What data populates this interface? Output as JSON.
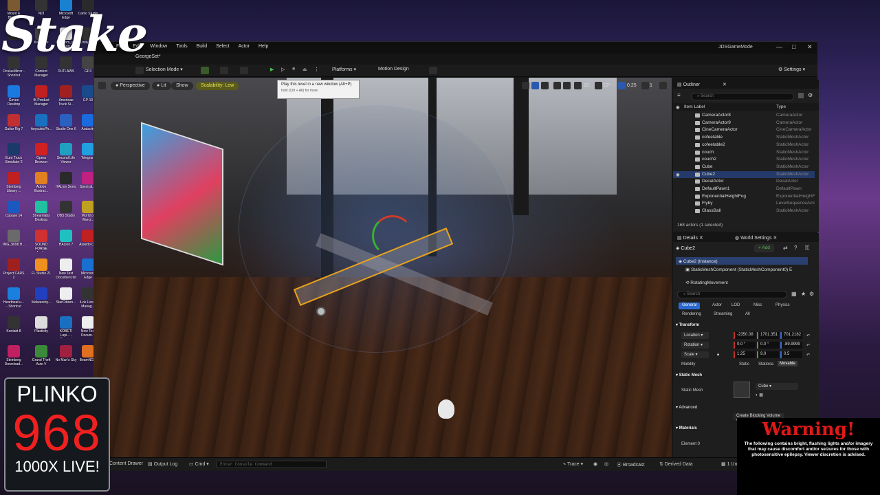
{
  "desktop": {
    "icons_col1": [
      {
        "label": "Mount & Blade II",
        "color": "#7a5a30"
      },
      {
        "label": "",
        "color": "#2a2a2a"
      },
      {
        "label": "OculusMirror - Shortcut",
        "color": "#333"
      },
      {
        "label": "Govee Desktop",
        "color": "#1a7ae0"
      },
      {
        "label": "Guitar Rig 7",
        "color": "#c03030"
      },
      {
        "label": "Euro Truck Simulator 2",
        "color": "#1a3a6a"
      },
      {
        "label": "Steinberg Library ...",
        "color": "#c02020"
      },
      {
        "label": "Cubase 14",
        "color": "#1a5ac0"
      },
      {
        "label": "IMG_9098.H...",
        "color": "#6a6a6a"
      },
      {
        "label": "Project CARS 2",
        "color": "#a02020"
      },
      {
        "label": "Heartbeat.u... - Shortcut",
        "color": "#1a80e0"
      },
      {
        "label": "Kontakt 8",
        "color": "#333"
      },
      {
        "label": "Steinberg Download...",
        "color": "#c02060"
      }
    ],
    "icons_col2": [
      {
        "label": "NDI",
        "color": "#333"
      },
      {
        "label": "Komplete",
        "color": "#444"
      },
      {
        "label": "Content Manager",
        "color": "#333"
      },
      {
        "label": "IK Product Manager",
        "color": "#c02020"
      },
      {
        "label": "AnycubicPh...",
        "color": "#1a70c0"
      },
      {
        "label": "Opera Browser",
        "color": "#d02020"
      },
      {
        "label": "Adobe Illustrat...",
        "color": "#e08020"
      },
      {
        "label": "Streamlabs Desktop",
        "color": "#20c0a0"
      },
      {
        "label": "SOUND FORGE Audi...",
        "color": "#d03030"
      },
      {
        "label": "FL Studio 21",
        "color": "#f09020"
      },
      {
        "label": "Malwareby...",
        "color": "#2040c0"
      },
      {
        "label": "Plasticity",
        "color": "#ddd"
      },
      {
        "label": "Grand Theft Auto V",
        "color": "#3a8a3a"
      }
    ],
    "icons_col3": [
      {
        "label": "Microsoft Edge",
        "color": "#1a80d0"
      },
      {
        "label": "Freedom_s... Shortcut",
        "color": "#ddd"
      },
      {
        "label": "OUTLAWS",
        "color": "#333"
      },
      {
        "label": "American Truck Si...",
        "color": "#a02020"
      },
      {
        "label": "Studio One 6",
        "color": "#2a60c0"
      },
      {
        "label": "Second Life Viewer",
        "color": "#20a0c0"
      },
      {
        "label": "HALion Sonic",
        "color": "#2a2a2a"
      },
      {
        "label": "OBS Studio",
        "color": "#333"
      },
      {
        "label": "HALion 7",
        "color": "#20c0c0"
      },
      {
        "label": "New Text Document.txt",
        "color": "#eee"
      },
      {
        "label": "StarCitizen...",
        "color": "#eee"
      },
      {
        "label": "KOBETI Lupi... - Shortcut",
        "color": "#1a70c0"
      },
      {
        "label": "No Man's Sky",
        "color": "#a02040"
      }
    ],
    "icons_col4": [
      {
        "label": "Camo Studio",
        "color": "#2a2a2a"
      },
      {
        "label": "Unity Hub",
        "color": "#333"
      },
      {
        "label": "GP4",
        "color": "#444"
      },
      {
        "label": "GP-10",
        "color": "#1a4a8a"
      },
      {
        "label": "Audacity",
        "color": "#1a6ae0"
      },
      {
        "label": "Telegram",
        "color": "#20a0e0"
      },
      {
        "label": "SpectraL...",
        "color": "#c02080"
      },
      {
        "label": "World of Warcr...",
        "color": "#c0a020"
      },
      {
        "label": "Assetto C...",
        "color": "#c02020"
      },
      {
        "label": "Microsoft Edge",
        "color": "#1a70d0"
      },
      {
        "label": "iLok Lice... Manag...",
        "color": "#333"
      },
      {
        "label": "New Text Docum...",
        "color": "#eee"
      },
      {
        "label": "BeamNG...",
        "color": "#e07020"
      }
    ]
  },
  "overlay": {
    "stake_logo": "Stake",
    "plinko_title": "PLINKO",
    "plinko_number": "968",
    "plinko_sub": "1000X LIVE!",
    "warning_title": "Warning!",
    "warning_text": "The following contains bright, flashing lights and/or imagery that may cause discomfort and/or seizures for those with photosensitive epilepsy. Viewer discretion is advised."
  },
  "editor": {
    "window_title": "JDSGameMode",
    "menu": [
      "File",
      "Edit",
      "Window",
      "Tools",
      "Build",
      "Select",
      "Actor",
      "Help"
    ],
    "level_tab": "GeorgeSet*",
    "toolbar": {
      "selection_mode": "Selection Mode",
      "platforms": "Platforms",
      "motion_design": "Motion Design",
      "settings": "Settings"
    },
    "viewport": {
      "perspective": "Perspective",
      "lit": "Lit",
      "show": "Show",
      "scalability": "Scalability: Low",
      "grid_snap": "10",
      "rot_snap": "10°",
      "scale_snap": "0.25",
      "camera_speed": "1",
      "tooltip_title": "Play this level in a new window (Alt+P)",
      "tooltip_hint": "hold (Ctrl + Alt) for more"
    },
    "bottom": {
      "content_drawer": "Content Drawer",
      "output_log": "Output Log",
      "cmd": "Cmd",
      "console_placeholder": "Enter Console Command",
      "trace": "Trace",
      "broadcast": "Broadcast",
      "derived_data": "Derived Data",
      "unsaved": "1 Un"
    },
    "outliner": {
      "title": "Outliner",
      "search_placeholder": "Search",
      "col_label": "Item Label",
      "col_type": "Type",
      "rows": [
        {
          "name": "CameraActor8",
          "type": "CameraActor",
          "selected": false
        },
        {
          "name": "CameraActor9",
          "type": "CameraActor",
          "selected": false
        },
        {
          "name": "CineCameraActor",
          "type": "CineCameraActor",
          "selected": false
        },
        {
          "name": "cofeetable",
          "type": "StaticMeshActor",
          "selected": false
        },
        {
          "name": "cofeetable2",
          "type": "StaticMeshActor",
          "selected": false
        },
        {
          "name": "couch",
          "type": "StaticMeshActor",
          "selected": false
        },
        {
          "name": "couch2",
          "type": "StaticMeshActor",
          "selected": false
        },
        {
          "name": "Cube",
          "type": "StaticMeshActor",
          "selected": false
        },
        {
          "name": "Cube2",
          "type": "StaticMeshActor",
          "selected": true
        },
        {
          "name": "DecalActor",
          "type": "DecalActor",
          "selected": false
        },
        {
          "name": "DefaultPawn1",
          "type": "DefaultPawn",
          "selected": false
        },
        {
          "name": "ExponentialHeightFog",
          "type": "ExponentialHeightFog",
          "selected": false
        },
        {
          "name": "Flyby",
          "type": "LevelSequenceActor",
          "selected": false
        },
        {
          "name": "GlassBall",
          "type": "StaticMeshActor",
          "selected": false
        }
      ],
      "status": "168 actors (1 selected)"
    },
    "details": {
      "tab_details": "Details",
      "tab_world": "World Settings",
      "object_name": "Cube2",
      "add_label": "+ Add",
      "instance_label": "Cube2 (Instance)",
      "component_label": "StaticMeshComponent (StaticMeshComponent0)",
      "component_suffix": "E",
      "rotating_label": "RotatingMovement",
      "search_placeholder": "Search",
      "categories_row1": [
        "General",
        "Actor",
        "LOD",
        "Misc",
        "Physics"
      ],
      "categories_row2": [
        "Rendering",
        "Streaming",
        "All"
      ],
      "transform_header": "Transform",
      "location_label": "Location",
      "location": [
        "-2350.08",
        "1701.351",
        "701.2182"
      ],
      "rotation_label": "Rotation",
      "rotation": [
        "0.0 °",
        "0.0 °",
        "-89.9999"
      ],
      "scale_label": "Scale",
      "scale": [
        "1.25",
        "9.0",
        "0.5"
      ],
      "mobility_label": "Mobility",
      "mobility_options": [
        "Static",
        "Stationa",
        "Movable"
      ],
      "static_mesh_header": "Static Mesh",
      "static_mesh_label": "Static Mesh",
      "static_mesh_value": "Cube",
      "advanced_label": "Advanced",
      "blocking_volume": "Create Blocking Volume",
      "materials_header": "Materials",
      "element0_label": "Element 0"
    }
  }
}
